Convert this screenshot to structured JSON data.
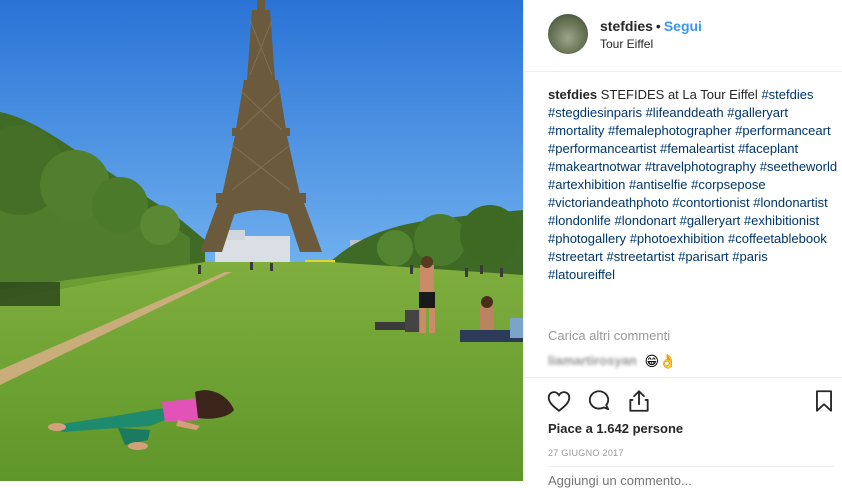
{
  "post": {
    "username": "stefdies",
    "separator": "•",
    "follow_label": "Segui",
    "location": "Tour Eiffel"
  },
  "caption": {
    "username": "stefdies",
    "text": "STEFIDES at La Tour Eiffel",
    "hashtags": [
      "#stefdies",
      "#stegdiesinparis",
      "#lifeanddeath",
      "#galleryart",
      "#mortality",
      "#femalephotographer",
      "#performanceart",
      "#performanceartist",
      "#femaleartist",
      "#faceplant",
      "#makeartnotwar",
      "#travelphotography",
      "#seetheworld",
      "#artexhibition",
      "#antiselfie",
      "#corpsepose",
      "#victoriandeathphoto",
      "#contortionist",
      "#londonartist",
      "#londonlife",
      "#londonart",
      "#galleryart",
      "#exhibitionist",
      "#photogallery",
      "#photoexhibition",
      "#coffeetablebook",
      "#streetart",
      "#streetartist",
      "#parisart",
      "#paris",
      "#latoureiffel"
    ]
  },
  "comments": {
    "load_more_label": "Carica altri commenti",
    "items": [
      {
        "username": "liamartirosyan",
        "emoji": "😁👌"
      }
    ]
  },
  "actions": {
    "like_icon": "heart-icon",
    "comment_icon": "comment-icon",
    "share_icon": "share-icon",
    "save_icon": "bookmark-icon"
  },
  "likes_text": "Piace a 1.642 persone",
  "date_text": "27 GIUGNO 2017",
  "add_comment_placeholder": "Aggiungi un commento...",
  "colors": {
    "link": "#3897f0",
    "hashtag": "#003569",
    "muted": "#999999",
    "text": "#262626"
  }
}
